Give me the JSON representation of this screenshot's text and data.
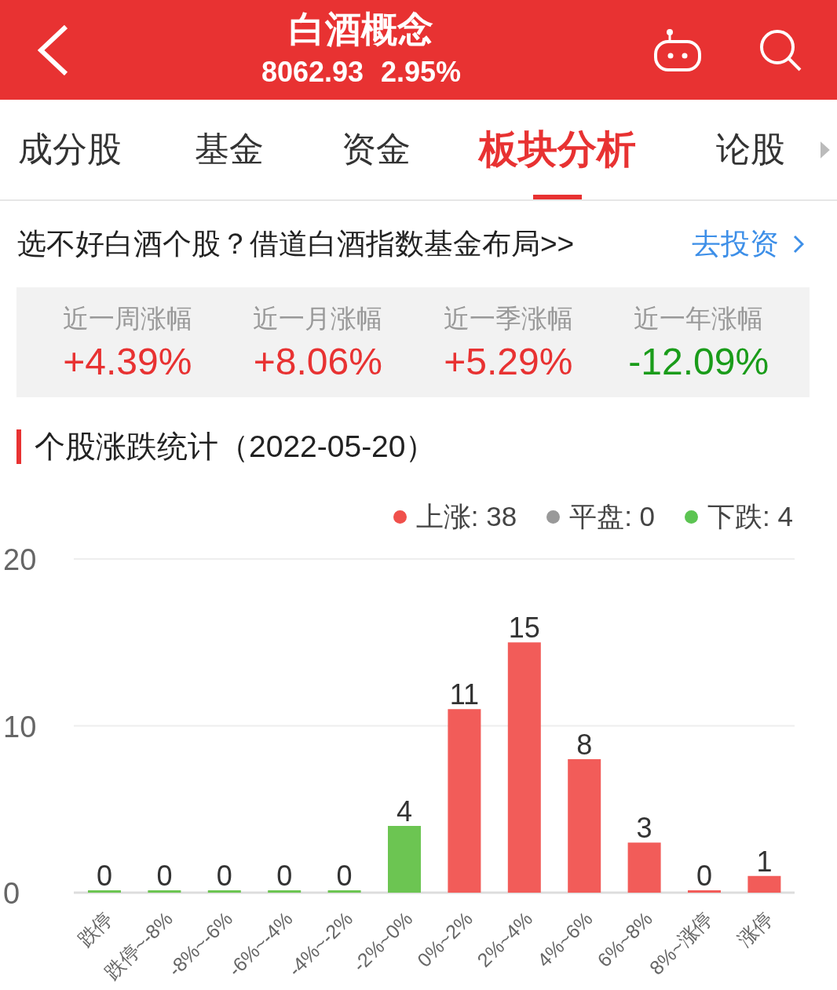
{
  "header": {
    "title": "白酒概念",
    "index": "8062.93",
    "change": "2.95%"
  },
  "tabs": [
    {
      "label": "成分股",
      "selected": false
    },
    {
      "label": "基金",
      "selected": false
    },
    {
      "label": "资金",
      "selected": false
    },
    {
      "label": "板块分析",
      "selected": true
    },
    {
      "label": "论股",
      "selected": false
    }
  ],
  "banner": {
    "text": "选不好白酒个股？借道白酒指数基金布局>>",
    "link": "去投资"
  },
  "stats": [
    {
      "label": "近一周涨幅",
      "value": "+4.39%",
      "color": "#e83232"
    },
    {
      "label": "近一月涨幅",
      "value": "+8.06%",
      "color": "#e83232"
    },
    {
      "label": "近一季涨幅",
      "value": "+5.29%",
      "color": "#e83232"
    },
    {
      "label": "近一年涨幅",
      "value": "-12.09%",
      "color": "#1a9c1a"
    }
  ],
  "section_title": "个股涨跌统计（2022-05-20）",
  "legend": [
    {
      "label": "上涨: 38",
      "color": "#f0504b"
    },
    {
      "label": "平盘: 0",
      "color": "#999999"
    },
    {
      "label": "下跌: 4",
      "color": "#5cc452"
    }
  ],
  "chart_data": {
    "type": "bar",
    "categories": [
      "跌停",
      "跌停~-8%",
      "-8%~-6%",
      "-6%~-4%",
      "-4%~-2%",
      "-2%~0%",
      "0%~2%",
      "2%~4%",
      "4%~6%",
      "6%~8%",
      "8%~涨停",
      "涨停"
    ],
    "series": [
      {
        "color": "#6cc552",
        "values": [
          0,
          0,
          0,
          0,
          0,
          4,
          null,
          null,
          null,
          null,
          null,
          null
        ]
      },
      {
        "color": "#f25c59",
        "values": [
          null,
          null,
          null,
          null,
          null,
          null,
          11,
          15,
          8,
          3,
          0,
          1
        ]
      }
    ],
    "ylim": [
      0,
      20
    ],
    "yticks": [
      0,
      10,
      20
    ],
    "data_labels": true
  }
}
